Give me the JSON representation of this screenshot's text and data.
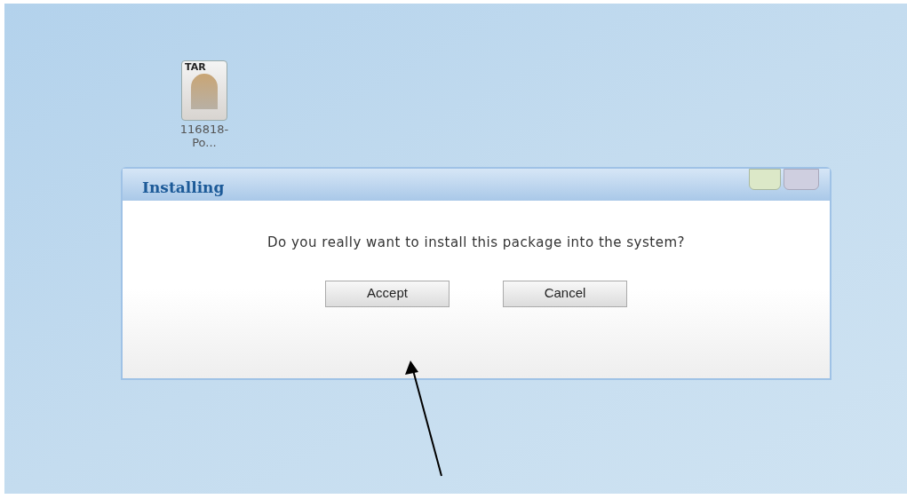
{
  "desktop_icon": {
    "badge": "TAR",
    "label": "116818-\nPo..."
  },
  "dialog": {
    "title": "Installing",
    "message": "Do you really want to install this package into the system?",
    "buttons": [
      "Accept",
      "Cancel"
    ]
  }
}
